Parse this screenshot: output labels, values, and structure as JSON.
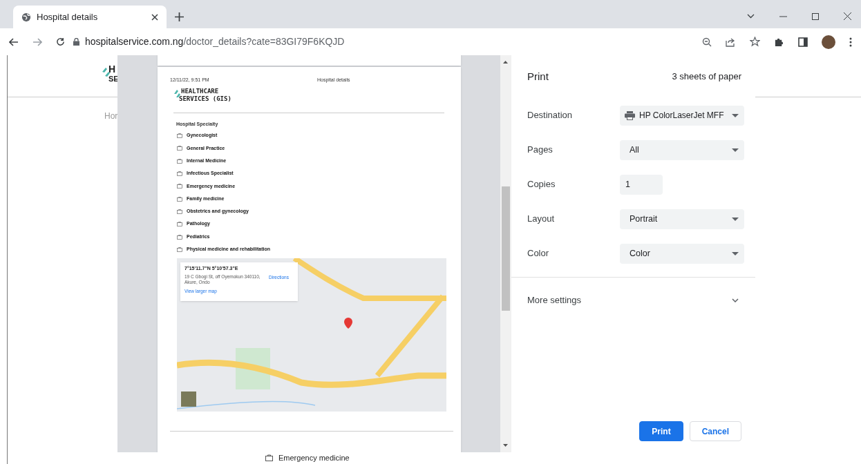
{
  "browser": {
    "tab_title": "Hospital details",
    "url_host": "hospitalservice.com.ng",
    "url_path": "/doctor_details?cate=83GI79F6KQJD"
  },
  "background_page": {
    "logo_line1": "H",
    "logo_line2": "SE",
    "breadcrumb": "Hor",
    "bottom_item": "Emergency medicine"
  },
  "preview": {
    "header_date": "12/11/22, 9:51 PM",
    "header_title": "Hospital details",
    "logo_line1": "HEALTHCARE",
    "logo_line2": "SERVICES (GIS)",
    "section_title": "Hospital Specialty",
    "specialties": [
      "Gynecologist",
      "General Practice",
      "Internal Medicine",
      "Infectious Specialist",
      "Emergency medicine",
      "Family medicine",
      "Obstetrics and gynecology",
      "Pathology",
      "Pediatrics",
      "Physical medicine and rehabilitation"
    ],
    "map": {
      "coordinates": "7°15'11.7\"N 5°10'57.3\"E",
      "address": "19 C Gbogi St, off Oyemokun 340110, Akure, Ondo",
      "directions": "Directions",
      "view_larger": "View larger map"
    }
  },
  "print_settings": {
    "title": "Print",
    "sheets": "3 sheets of paper",
    "fields": [
      {
        "label": "Destination",
        "kind": "printer_select",
        "value": "HP ColorLaserJet MFF"
      },
      {
        "label": "Pages",
        "kind": "select",
        "value": "All"
      },
      {
        "label": "Copies",
        "kind": "input",
        "value": "1"
      },
      {
        "label": "Layout",
        "kind": "select",
        "value": "Portrait"
      },
      {
        "label": "Color",
        "kind": "select",
        "value": "Color"
      }
    ],
    "more_settings": {
      "label": "More settings",
      "expanded": false
    },
    "buttons": [
      {
        "label": "Print",
        "kind": "primary"
      },
      {
        "label": "Cancel",
        "kind": "secondary"
      }
    ]
  }
}
